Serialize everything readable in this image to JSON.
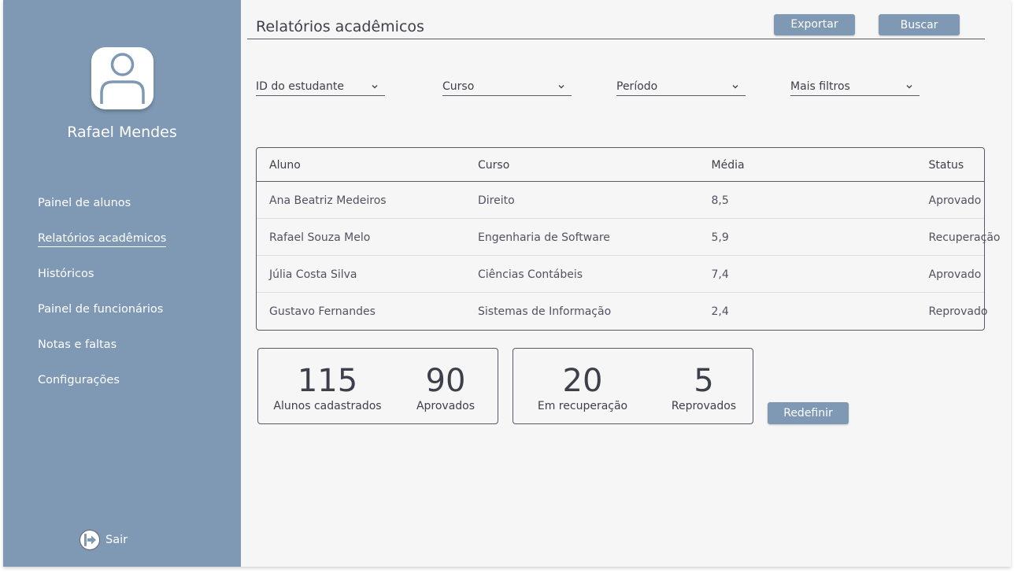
{
  "sidebar": {
    "user_name": "Rafael Mendes",
    "items": [
      {
        "label": "Painel de alunos"
      },
      {
        "label": "Relatórios acadêmicos",
        "active": true
      },
      {
        "label": "Históricos"
      },
      {
        "label": "Painel de funcionários"
      },
      {
        "label": "Notas e faltas"
      },
      {
        "label": "Configurações"
      }
    ],
    "logout_label": "Sair"
  },
  "header": {
    "title": "Relatórios acadêmicos",
    "export_label": "Exportar",
    "search_label": "Buscar"
  },
  "filters": [
    {
      "label": "ID do estudante"
    },
    {
      "label": "Curso"
    },
    {
      "label": "Período"
    },
    {
      "label": "Mais filtros"
    }
  ],
  "table": {
    "columns": [
      "Aluno",
      "Curso",
      "Média",
      "Status"
    ],
    "rows": [
      {
        "aluno": "Ana Beatriz Medeiros",
        "curso": "Direito",
        "media": "8,5",
        "status": "Aprovado"
      },
      {
        "aluno": "Rafael Souza Melo",
        "curso": "Engenharia de Software",
        "media": "5,9",
        "status": "Recuperação"
      },
      {
        "aluno": "Júlia Costa Silva",
        "curso": "Ciências Contábeis",
        "media": "7,4",
        "status": "Aprovado"
      },
      {
        "aluno": "Gustavo Fernandes",
        "curso": "Sistemas de Informação",
        "media": "2,4",
        "status": "Reprovado"
      }
    ]
  },
  "stats": {
    "cadastrados": {
      "value": "115",
      "label": "Alunos cadastrados"
    },
    "aprovados": {
      "value": "90",
      "label": "Aprovados"
    },
    "recuperacao": {
      "value": "20",
      "label": "Em recuperação"
    },
    "reprovados": {
      "value": "5",
      "label": "Reprovados"
    }
  },
  "reset_label": "Redefinir",
  "colors": {
    "sidebar": "#7f99b4",
    "accent": "#7f99b4",
    "text": "#3d3f4a",
    "background": "#f6f6f6"
  },
  "icons": {
    "avatar": "user-icon",
    "logout": "logout-icon",
    "filter_dropdown": "chevron-down-icon"
  }
}
